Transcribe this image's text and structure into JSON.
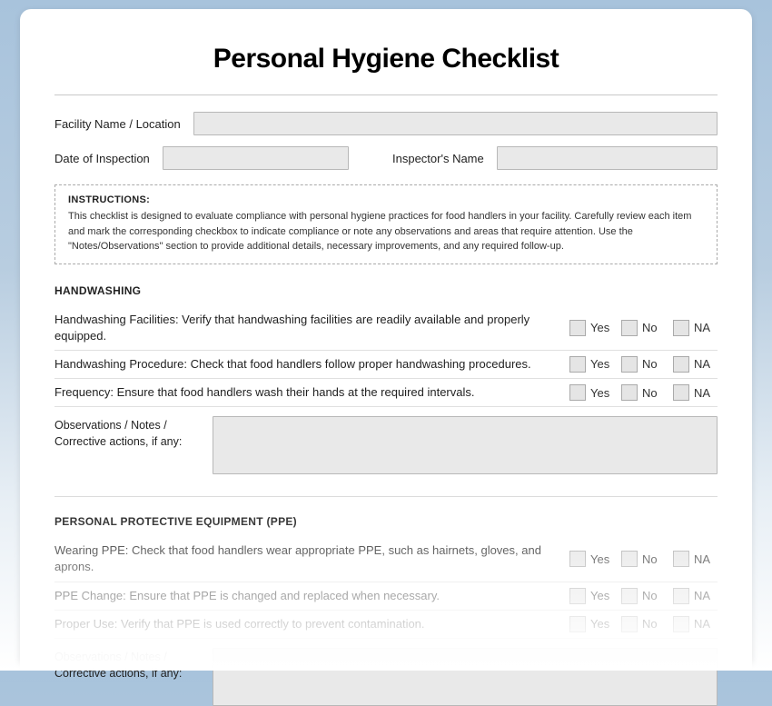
{
  "title": "Personal Hygiene Checklist",
  "fields": {
    "facility_label": "Facility Name / Location",
    "date_label": "Date of Inspection",
    "inspector_label": "Inspector's Name"
  },
  "instructions": {
    "heading": "INSTRUCTIONS:",
    "text": "This checklist is designed to evaluate compliance with personal hygiene practices for food handlers in your facility. Carefully review each item and mark the corresponding checkbox to indicate compliance or note any observations and areas that require attention. Use the \"Notes/Observations\" section to provide additional details, necessary improvements, and any required follow-up."
  },
  "labels": {
    "yes": "Yes",
    "no": "No",
    "na": "NA",
    "observations": "Observations / Notes / Corrective actions, if any:"
  },
  "sections": [
    {
      "heading": "HANDWASHING",
      "items": [
        "Handwashing Facilities: Verify that handwashing facilities are readily available and properly equipped.",
        "Handwashing Procedure: Check that food handlers follow proper handwashing procedures.",
        "Frequency: Ensure that food handlers wash their hands at the required intervals."
      ]
    },
    {
      "heading": "PERSONAL PROTECTIVE EQUIPMENT (PPE)",
      "items": [
        "Wearing PPE: Check that food handlers wear appropriate PPE, such as hairnets, gloves, and aprons.",
        "PPE Change: Ensure that PPE is changed and replaced when necessary.",
        "Proper Use: Verify that PPE is used correctly to prevent contamination."
      ]
    }
  ]
}
